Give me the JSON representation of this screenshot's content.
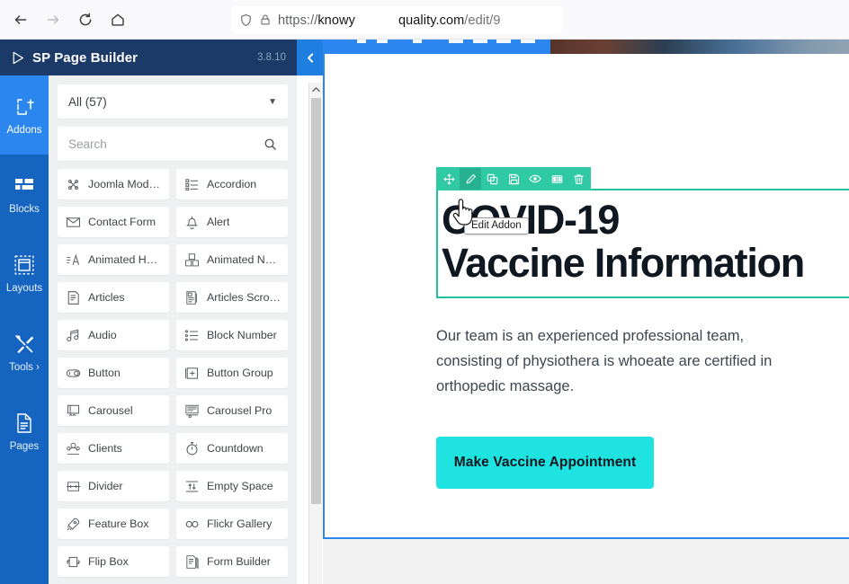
{
  "browser": {
    "nav": {
      "back": "back-arrow",
      "forward": "forward-arrow",
      "reload": "reload-icon",
      "home": "home-icon"
    },
    "url": {
      "scheme": "https://",
      "host_start": "knowy",
      "host_end": "quality.com",
      "path": "/edit/9",
      "redacted": true,
      "shield_icon": "shield-icon",
      "lock_icon": "padlock-icon"
    }
  },
  "pagebuilder": {
    "title": "SP Page Builder",
    "version": "3.8.10",
    "logo_icon": "play-triangle-icon",
    "collapse_icon": "chevron-left-icon"
  },
  "rail": {
    "items": [
      {
        "label": "Addons",
        "icon": "add-page-icon",
        "active": true
      },
      {
        "label": "Blocks",
        "icon": "blocks-grid-icon",
        "active": false
      },
      {
        "label": "Layouts",
        "icon": "layout-frame-icon",
        "active": false
      },
      {
        "label": "Tools ›",
        "icon": "tools-wrench-icon",
        "active": false
      },
      {
        "label": "Pages",
        "icon": "document-icon",
        "active": false
      }
    ]
  },
  "panel": {
    "filter_label": "All (57)",
    "filter_caret": "chevron-down-icon",
    "search_placeholder": "Search",
    "search_value": "",
    "search_icon": "search-icon",
    "scroll_up_icon": "chevron-up-icon",
    "addons": [
      {
        "name": "Joomla Module",
        "icon": "joomla-icon"
      },
      {
        "name": "Accordion",
        "icon": "accordion-icon"
      },
      {
        "name": "Contact Form",
        "icon": "envelope-icon"
      },
      {
        "name": "Alert",
        "icon": "bell-icon"
      },
      {
        "name": "Animated Hea…",
        "icon": "animated-heading-icon"
      },
      {
        "name": "Animated Nu…",
        "icon": "animated-number-icon"
      },
      {
        "name": "Articles",
        "icon": "article-icon"
      },
      {
        "name": "Articles Scroller",
        "icon": "articles-scroller-icon"
      },
      {
        "name": "Audio",
        "icon": "music-note-icon"
      },
      {
        "name": "Block Number",
        "icon": "ordered-list-icon"
      },
      {
        "name": "Button",
        "icon": "button-toggle-icon"
      },
      {
        "name": "Button Group",
        "icon": "button-group-icon"
      },
      {
        "name": "Carousel",
        "icon": "carousel-icon"
      },
      {
        "name": "Carousel Pro",
        "icon": "carousel-pro-icon"
      },
      {
        "name": "Clients",
        "icon": "clients-icon"
      },
      {
        "name": "Countdown",
        "icon": "stopwatch-icon"
      },
      {
        "name": "Divider",
        "icon": "divider-icon"
      },
      {
        "name": "Empty Space",
        "icon": "up-down-arrow-icon"
      },
      {
        "name": "Feature Box",
        "icon": "rocket-icon"
      },
      {
        "name": "Flickr Gallery",
        "icon": "flickr-dots-icon"
      },
      {
        "name": "Flip Box",
        "icon": "flip-box-icon"
      },
      {
        "name": "Form Builder",
        "icon": "form-builder-icon"
      }
    ]
  },
  "canvas": {
    "toolbar": {
      "tooltip": "Edit Addon",
      "buttons": [
        {
          "name": "move",
          "icon": "move-arrows-icon",
          "active": false
        },
        {
          "name": "edit",
          "icon": "pencil-icon",
          "active": true
        },
        {
          "name": "duplicate",
          "icon": "copy-icon",
          "active": false
        },
        {
          "name": "save",
          "icon": "floppy-save-icon",
          "active": false
        },
        {
          "name": "visibility",
          "icon": "eye-icon",
          "active": false
        },
        {
          "name": "columns",
          "icon": "columns-icon",
          "active": false
        },
        {
          "name": "delete",
          "icon": "trash-icon",
          "active": false
        }
      ]
    },
    "heading_line1": "COVID-19",
    "heading_line2": "Vaccine Information",
    "body": "Our team is an experienced professional team, consisting of physiothera is whoeate are certified in orthopedic massage.",
    "cta_label": "Make Vaccine Appointment"
  },
  "colors": {
    "header_navy": "#1b3a68",
    "rail_blue": "#1565c0",
    "rail_active": "#2b87ef",
    "accent_blue": "#1f7fe0",
    "selection_teal": "#2fc9a4",
    "cta_cyan": "#1fe3e0",
    "panel_bg": "#eef0f2"
  }
}
